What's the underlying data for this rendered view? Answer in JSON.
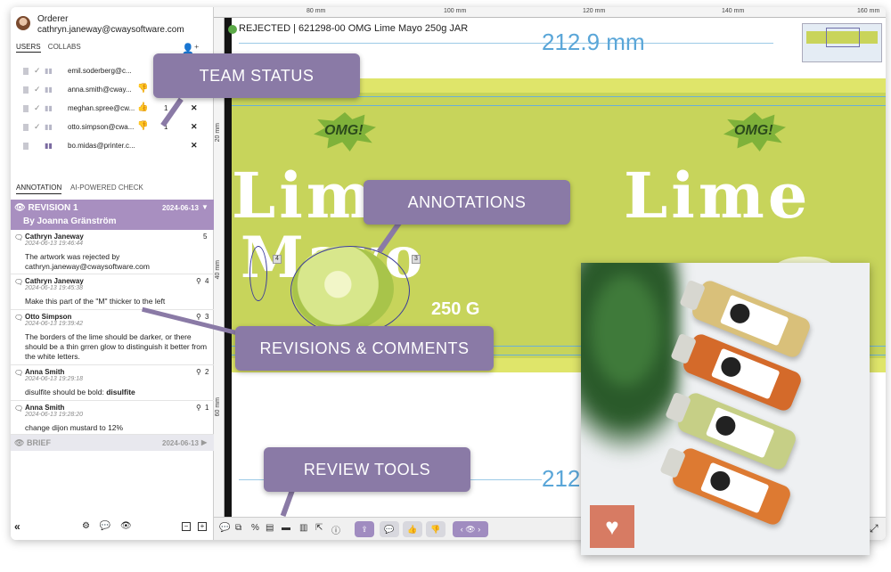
{
  "user": {
    "role": "Orderer",
    "email": "cathryn.janeway@cwaysoftware.com"
  },
  "user_tabs": [
    "USERS",
    "COLLABS"
  ],
  "users": [
    {
      "name": "emil.soderberg@c...",
      "thumb": "",
      "count": "",
      "remove": ""
    },
    {
      "name": "anna.smith@cway...",
      "thumb": "down",
      "count": "",
      "remove": ""
    },
    {
      "name": "meghan.spree@cw...",
      "thumb": "up",
      "count": "1",
      "remove": "✕"
    },
    {
      "name": "otto.simpson@cwa...",
      "thumb": "down",
      "count": "1",
      "remove": "✕"
    },
    {
      "name": "bo.midas@printer.c...",
      "thumb": "",
      "count": "",
      "remove": "✕"
    }
  ],
  "annotation_tabs": [
    "ANNOTATION",
    "AI-POWERED CHECK"
  ],
  "revision": {
    "title": "REVISION 1",
    "author": "By Joanna Gränström",
    "date": "2024-06-13"
  },
  "comments": [
    {
      "author": "Cathryn Janeway",
      "time": "2024-06-13 19:46:44",
      "number": "5",
      "body": "The artwork was rejected by cathryn.janeway@cwaysoftware.com"
    },
    {
      "author": "Cathryn Janeway",
      "time": "2024-06-13 19:45:38",
      "number": "4",
      "body": "Make this part of the \"M\" thicker to the left"
    },
    {
      "author": "Otto Simpson",
      "time": "2024-06-13 19:39:42",
      "number": "3",
      "body": "The borders of the lime should be darker, or there should be a thin grren glow to distinguish it better from the white letters."
    },
    {
      "author": "Anna Smith",
      "time": "2024-06-13 19:29:18",
      "number": "2",
      "body": "disulfite should be bold: disulfite"
    },
    {
      "author": "Anna Smith",
      "time": "2024-06-13 19:28:20",
      "number": "1",
      "body": "change dijon mustard to 12%"
    }
  ],
  "comment4_bold": "disulfite",
  "comment4_plain": "disulfite should be bold: ",
  "brief": {
    "title": "BRIEF",
    "date": "2024-06-13"
  },
  "status": {
    "state": "REJECTED",
    "job": "621298-00 OMG Lime Mayo 250g JAR",
    "color": "#5caa48"
  },
  "ruler_top": [
    "80 mm",
    "100 mm",
    "120 mm",
    "140 mm",
    "160 mm"
  ],
  "ruler_left": [
    "20 mm",
    "40 mm",
    "60 mm",
    "80 mm"
  ],
  "dimension_top": "212.9 mm",
  "dimension_bottom": "212",
  "artwork": {
    "brand": "OMG!",
    "word1": "Lime",
    "word2": "Mayo",
    "weight": "250 G"
  },
  "pins": [
    "4",
    "3"
  ],
  "callouts": {
    "team_status": "TEAM STATUS",
    "annotations": "ANNOTATIONS",
    "revisions": "REVISIONS & COMMENTS",
    "review_tools": "REVIEW TOOLS"
  },
  "accent": "#a88fc0",
  "icons": [
    "avatar",
    "add-user-icon",
    "group-icon",
    "eye-icon",
    "comment-icon",
    "pin-icon",
    "collapse-icon",
    "heart-pulse-icon",
    "expand-icon"
  ]
}
